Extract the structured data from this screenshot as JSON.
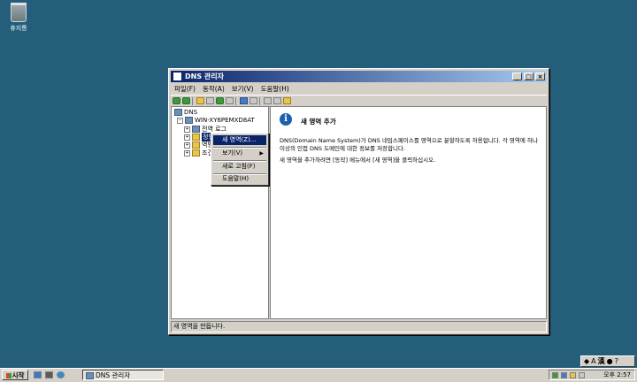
{
  "desktop": {
    "recycle_bin_label": "휴지통"
  },
  "window": {
    "title": "DNS 관리자",
    "menu": [
      "파일(F)",
      "동작(A)",
      "보기(V)",
      "도움말(H)"
    ],
    "tree": {
      "root": "DNS",
      "server": "WIN-XY6PEMXD8AT",
      "children": [
        "전역 로그",
        "정방향 조회 영역",
        "역방향 조회 영역",
        "조건부 전달자"
      ]
    },
    "content": {
      "title": "새 영역 추가",
      "description": "DNS(Domain Name System)가 DNS 네임스페이스를 영역으로 분할하도록 허용합니다. 각 영역에 하나 이상의 인접 DNS 도메인에 대한 정보를 저장합니다.",
      "hint": "새 영역을 추가하려면 [동작] 메뉴에서 [새 영역]을 클릭하십시오."
    },
    "status": "새 영역을 만듭니다."
  },
  "context_menu": [
    "새 영역(Z)...",
    "보기(V)",
    "새로 고침(F)",
    "도움말(H)"
  ],
  "taskbar": {
    "start_label": "시작",
    "task_label": "DNS 관리자",
    "clock": "오후 2:57"
  },
  "langbar": {
    "mode_a": "A",
    "mode_han": "漢"
  }
}
